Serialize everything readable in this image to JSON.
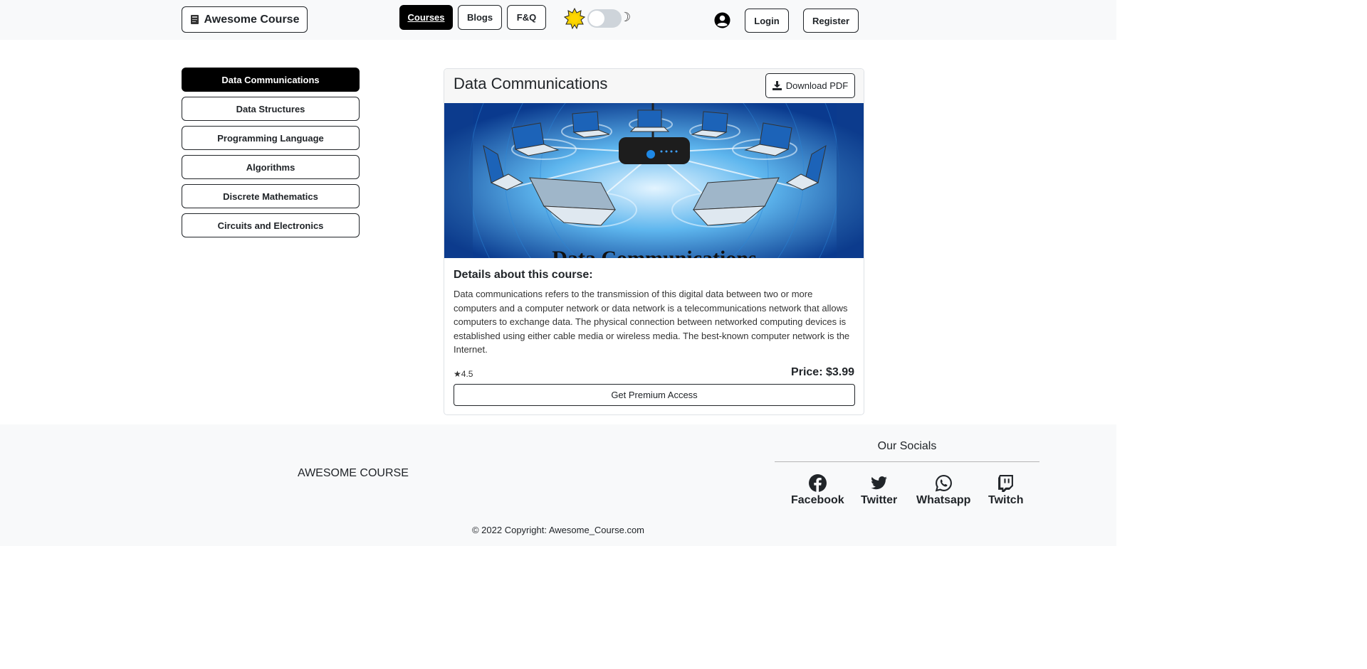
{
  "header": {
    "brand": "Awesome Course",
    "nav": [
      "Courses",
      "Blogs",
      "F&Q"
    ],
    "active_nav": "Courses",
    "login": "Login",
    "register": "Register",
    "theme_toggle": {
      "light_icon": "sun-icon",
      "dark_icon": "moon-icon",
      "state": "off"
    }
  },
  "sidebar": {
    "items": [
      {
        "label": "Data Communications",
        "active": true
      },
      {
        "label": "Data Structures",
        "active": false
      },
      {
        "label": "Programming Language",
        "active": false
      },
      {
        "label": "Algorithms",
        "active": false
      },
      {
        "label": "Discrete Mathematics",
        "active": false
      },
      {
        "label": "Circuits and Electronics",
        "active": false
      }
    ]
  },
  "course": {
    "title": "Data Communications",
    "download_label": "Download PDF",
    "image_caption": "Data Communications",
    "details_title": "Details about this course:",
    "description": "Data communications refers to the transmission of this digital data between two or more computers and a computer network or data network is a telecommunications network that allows computers to exchange data. The physical connection between networked computing devices is established using either cable media or wireless media. The best-known computer network is the Internet.",
    "rating": "4.5",
    "price": "Price: $3.99",
    "premium_label": "Get Premium Access"
  },
  "footer": {
    "brand": "AWESOME COURSE",
    "socials_title": "Our Socials",
    "socials": [
      {
        "label": "Facebook",
        "icon": "facebook-icon"
      },
      {
        "label": "Twitter",
        "icon": "twitter-icon"
      },
      {
        "label": "Whatsapp",
        "icon": "whatsapp-icon"
      },
      {
        "label": "Twitch",
        "icon": "twitch-icon"
      }
    ],
    "copyright": "© 2022 Copyright: Awesome_Course.com"
  },
  "colors": {
    "primary": "#000000",
    "background": "#f8f9fa",
    "hero_blue": "#1565c0"
  }
}
